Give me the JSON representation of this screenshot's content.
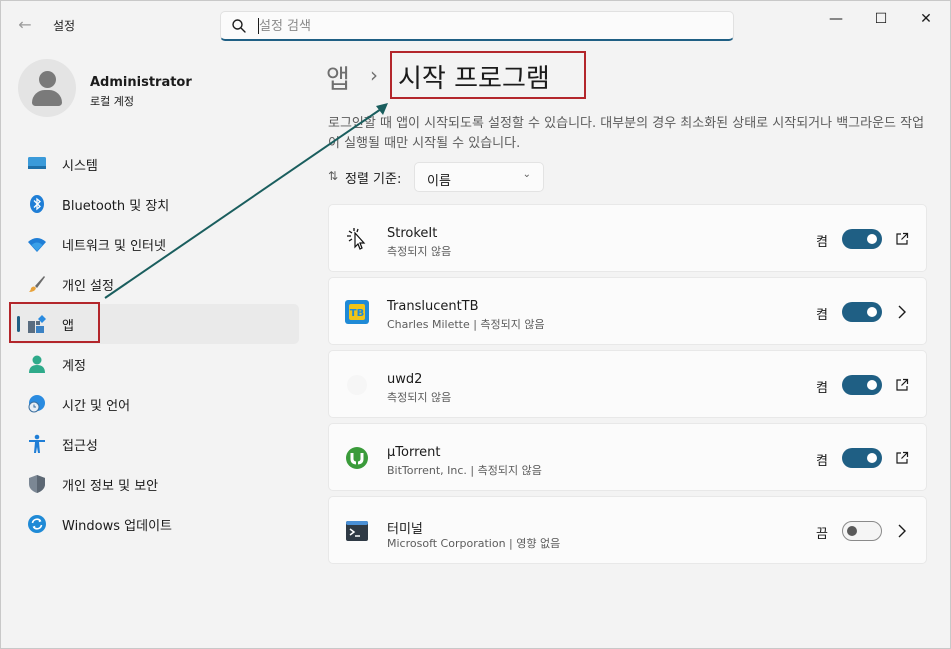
{
  "titlebar": {
    "app_title": "설정",
    "search_placeholder": "설정 검색",
    "minimize": "—",
    "maximize": "☐",
    "close": "✕"
  },
  "profile": {
    "name": "Administrator",
    "account_type": "로컬 계정"
  },
  "nav": {
    "items": [
      {
        "label": "시스템",
        "icon": "monitor-icon"
      },
      {
        "label": "Bluetooth 및 장치",
        "icon": "bluetooth-icon"
      },
      {
        "label": "네트워크 및 인터넷",
        "icon": "wifi-icon"
      },
      {
        "label": "개인 설정",
        "icon": "brush-icon"
      },
      {
        "label": "앱",
        "icon": "apps-icon",
        "active": true
      },
      {
        "label": "계정",
        "icon": "person-icon"
      },
      {
        "label": "시간 및 언어",
        "icon": "globe-clock-icon"
      },
      {
        "label": "접근성",
        "icon": "accessibility-icon"
      },
      {
        "label": "개인 정보 및 보안",
        "icon": "shield-icon"
      },
      {
        "label": "Windows 업데이트",
        "icon": "update-icon"
      }
    ]
  },
  "breadcrumb": {
    "parent": "앱",
    "separator": "›",
    "current": "시작 프로그램"
  },
  "description": "로그인할 때 앱이 시작되도록 설정할 수 있습니다. 대부분의 경우 최소화된 상태로 시작되거나 백그라운드 작업이 실행될 때만 시작될 수 있습니다.",
  "sort": {
    "label": "정렬 기준:",
    "value": "이름"
  },
  "apps": [
    {
      "name": "StrokeIt",
      "sub": "측정되지 않음",
      "state": "켬",
      "on": true,
      "action": "external-link-icon"
    },
    {
      "name": "TranslucentTB",
      "sub": "Charles Milette  |  측정되지 않음",
      "state": "켬",
      "on": true,
      "action": "chevron-right-icon"
    },
    {
      "name": "uwd2",
      "sub": "측정되지 않음",
      "state": "켬",
      "on": true,
      "action": "external-link-icon"
    },
    {
      "name": "µTorrent",
      "sub": "BitTorrent, Inc.  |  측정되지 않음",
      "state": "켬",
      "on": true,
      "action": "external-link-icon"
    },
    {
      "name": "터미널",
      "sub": "Microsoft Corporation  |  영향 없음",
      "state": "끔",
      "on": false,
      "action": "chevron-right-icon"
    }
  ],
  "colors": {
    "accent": "#1f5f84",
    "annotation": "#b3262b",
    "arrow": "#1a5e5e"
  }
}
